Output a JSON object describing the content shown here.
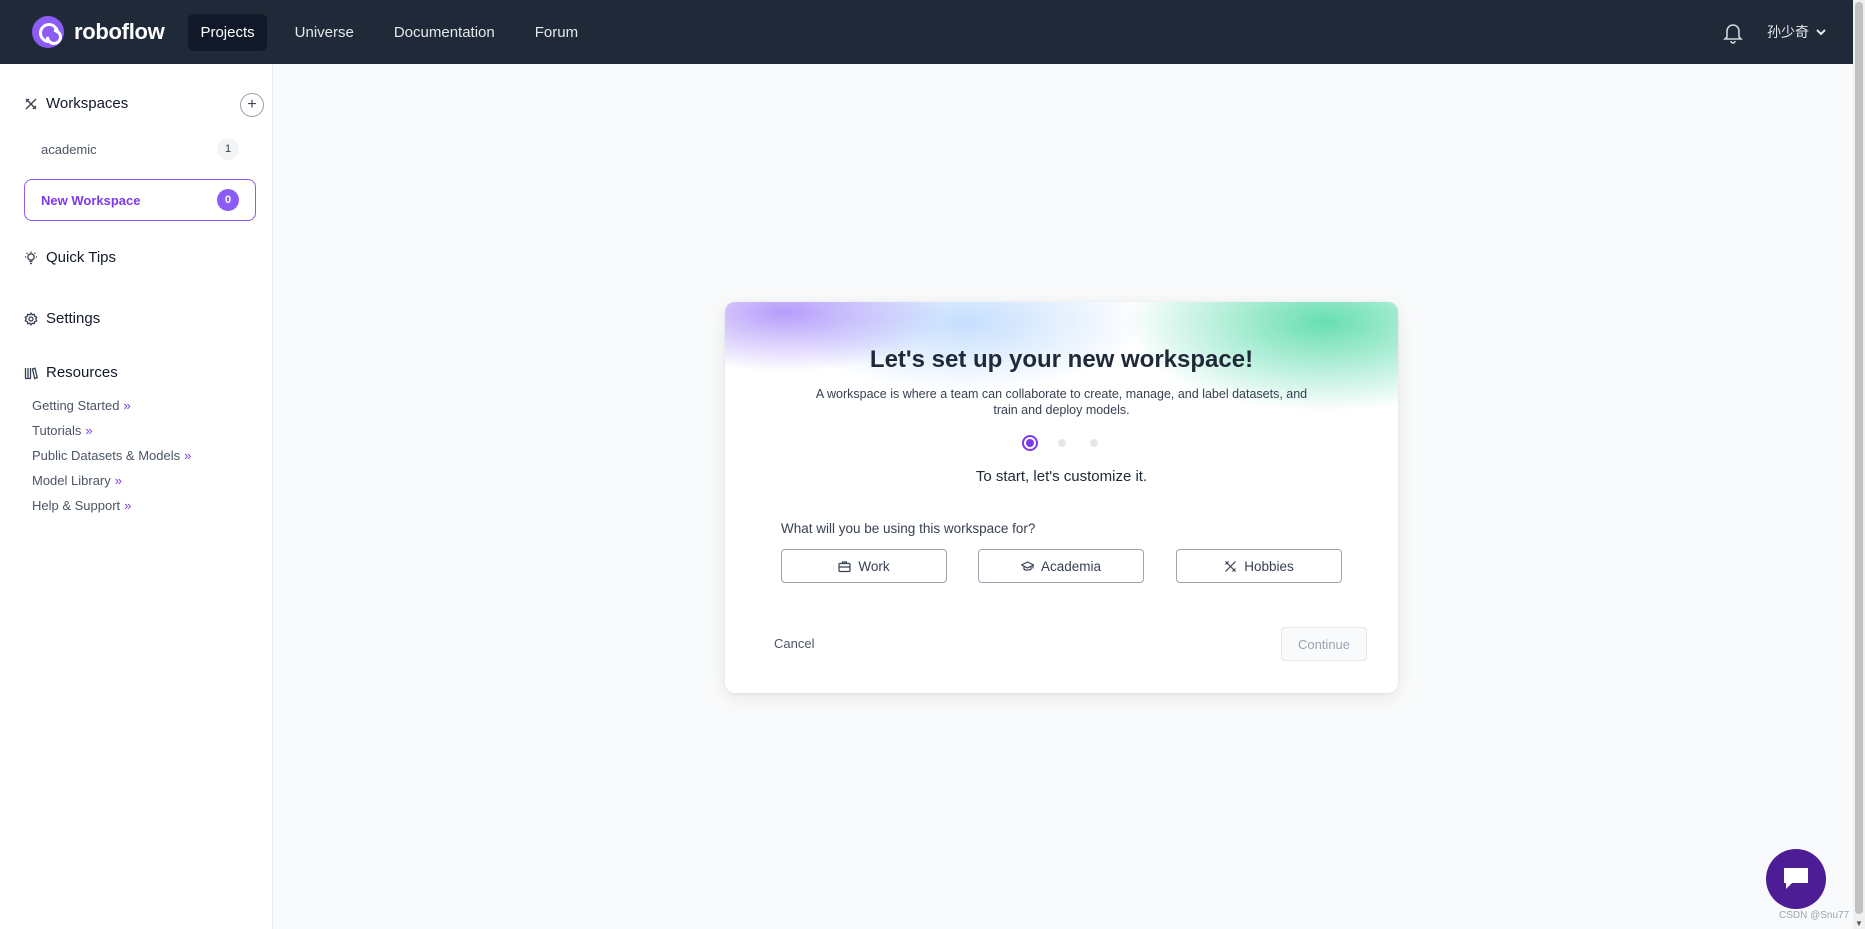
{
  "header": {
    "brand": "roboflow",
    "nav": [
      {
        "label": "Projects",
        "active": true
      },
      {
        "label": "Universe",
        "active": false
      },
      {
        "label": "Documentation",
        "active": false
      },
      {
        "label": "Forum",
        "active": false
      }
    ],
    "user_name": "孙少奇"
  },
  "sidebar": {
    "workspaces_label": "Workspaces",
    "workspaces": [
      {
        "name": "academic",
        "count": "1"
      }
    ],
    "new_workspace": {
      "name": "New Workspace",
      "count": "0"
    },
    "quick_tips_label": "Quick Tips",
    "settings_label": "Settings",
    "resources_label": "Resources",
    "resources": [
      "Getting Started",
      "Tutorials",
      "Public Datasets & Models",
      "Model Library",
      "Help & Support"
    ],
    "link_arrow": "»"
  },
  "modal": {
    "title": "Let's set up your new workspace!",
    "description": "A workspace is where a team can collaborate to create, manage, and label datasets, and train and deploy models.",
    "step_current": 1,
    "step_total": 3,
    "subtitle": "To start, let's customize it.",
    "question": "What will you be using this workspace for?",
    "options": [
      {
        "label": "Work",
        "icon": "briefcase-icon"
      },
      {
        "label": "Academia",
        "icon": "graduation-cap-icon"
      },
      {
        "label": "Hobbies",
        "icon": "tools-icon"
      }
    ],
    "cancel_label": "Cancel",
    "continue_label": "Continue"
  },
  "watermark": "CSDN @Snu77",
  "colors": {
    "topbar": "#1f2937",
    "accent": "#8b5cf6",
    "chat": "#4c1d95"
  }
}
